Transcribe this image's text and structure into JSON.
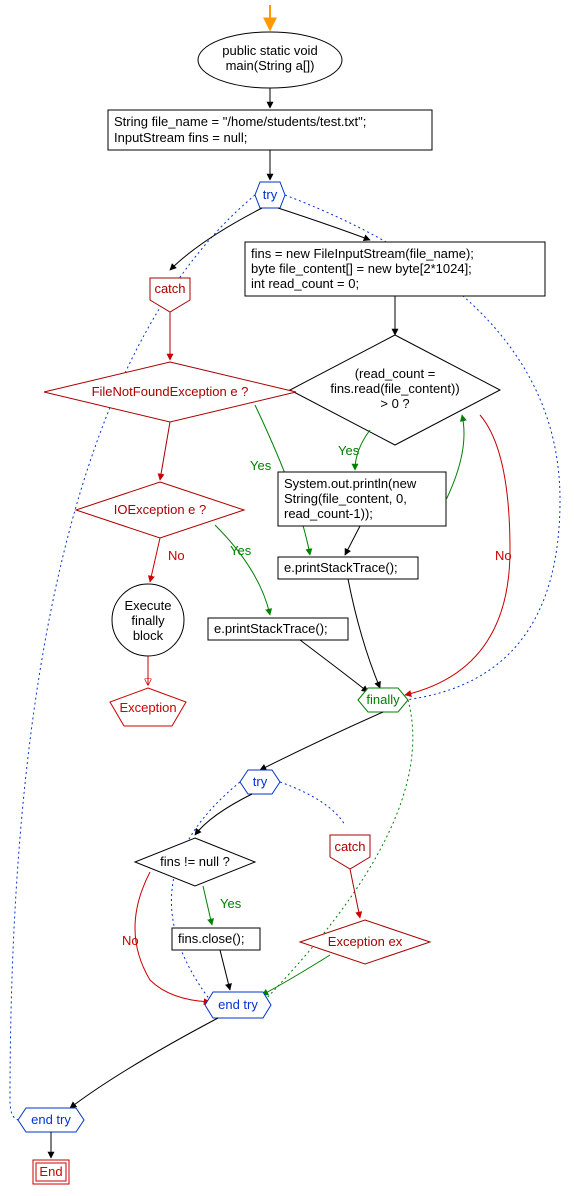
{
  "entry": {
    "main_signature_l1": "public static void",
    "main_signature_l2": "main(String a[])"
  },
  "init": {
    "line1": "String file_name = \"/home/students/test.txt\";",
    "line2": "InputStream fins = null;"
  },
  "try_label": "try",
  "catch_label": "catch",
  "finally_label": "finally",
  "end_try_label": "end try",
  "end_label": "End",
  "yes_label": "Yes",
  "no_label": "No",
  "try_body": {
    "line1": "fins = new FileInputStream(file_name);",
    "line2": "byte file_content[] = new byte[2*1024];",
    "line3": "int read_count = 0;"
  },
  "read_cond": {
    "line1": "(read_count =",
    "line2": "fins.read(file_content))",
    "line3": "> 0 ?"
  },
  "print_stmt": {
    "line1": "System.out.println(new",
    "line2": "String(file_content, 0,",
    "line3": "read_count-1));"
  },
  "catch1": {
    "cond": "FileNotFoundException e ?",
    "action": "e.printStackTrace();"
  },
  "catch2": {
    "cond": "IOException e ?",
    "action": "e.printStackTrace();"
  },
  "finally_exec": {
    "line1": "Execute",
    "line2": "finally",
    "line3": "block"
  },
  "exception_label": "Exception",
  "inner": {
    "cond": "fins != null ?",
    "close": "fins.close();",
    "catch_cond": "Exception ex"
  }
}
